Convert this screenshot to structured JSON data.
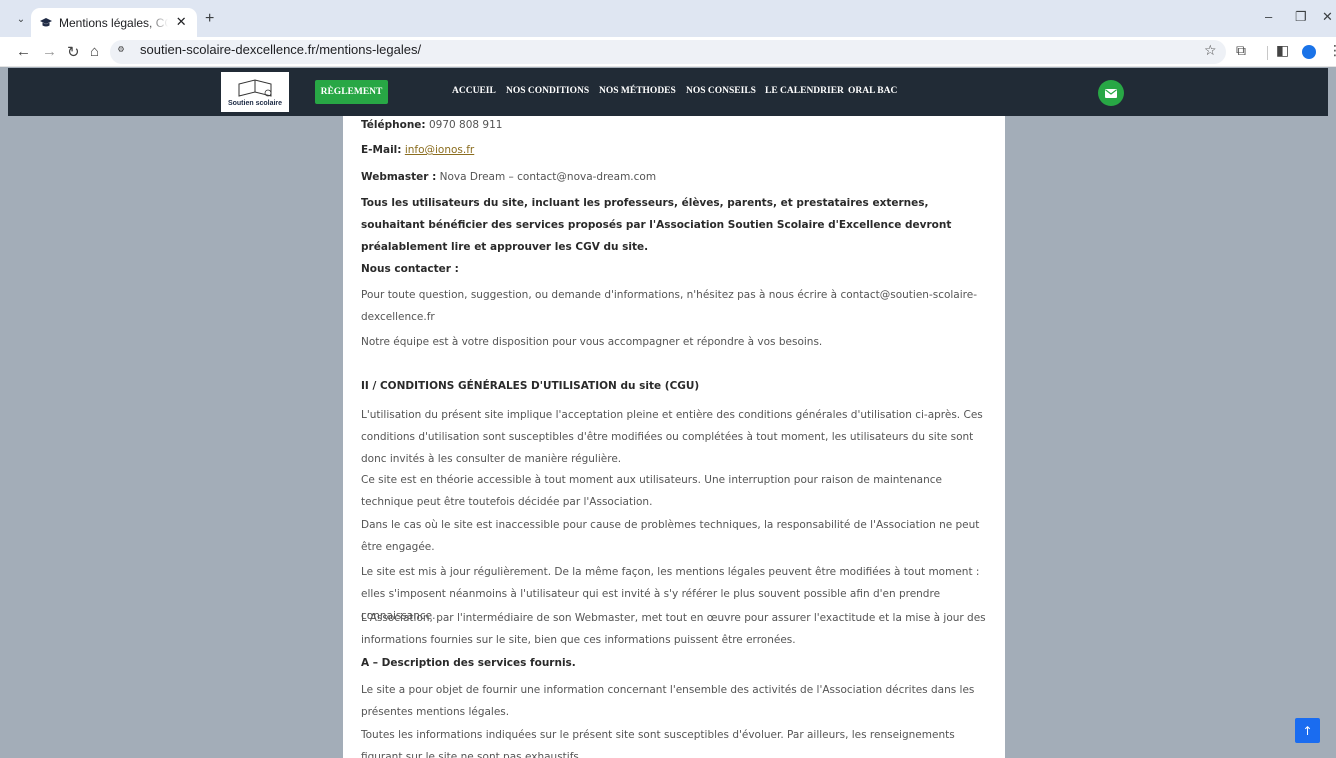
{
  "browser": {
    "tab_title": "Mentions légales, CGU et politique",
    "tab_list_icon": "⌄",
    "close_tab": "✕",
    "new_tab": "+",
    "url": "soutien-scolaire-dexcellence.fr/mentions-legales/",
    "window": {
      "minimize": "–",
      "maximize": "❐",
      "close": "✕"
    }
  },
  "site": {
    "logo_text": "Soutien scolaire",
    "button_reglement": "RÈGLEMENT",
    "menu": [
      "ACCUEIL",
      "NOS CONDITIONS",
      "NOS MÉTHODES",
      "NOS CONSEILS",
      "LE CALENDRIER",
      "ORAL BAC"
    ]
  },
  "content": {
    "telephone_label": "Téléphone:",
    "telephone_value": "0970 808 911",
    "email_label": "E-Mail:",
    "email_value": "info@ionos.fr",
    "webmaster_label": "Webmaster :",
    "webmaster_value": "Nova Dream – contact@nova-dream.com",
    "users_notice": "Tous les utilisateurs du site, incluant les professeurs, élèves, parents, et prestataires externes, souhaitant bénéficier des services proposés par l'Association Soutien Scolaire d'Excellence devront préalablement lire et approuver les CGV du site.",
    "contact_heading": "Nous contacter :",
    "contact_p1": "Pour toute question, suggestion, ou demande d'informations, n'hésitez pas à nous écrire à contact@soutien-scolaire-dexcellence.fr",
    "contact_p2": "Notre équipe est à votre disposition pour vous accompagner et répondre à vos besoins.",
    "cgu_heading": "II / CONDITIONS GÉNÉRALES D'UTILISATION du site (CGU)",
    "cgu_p1": "L'utilisation du présent site implique l'acceptation pleine et entière des conditions générales d'utilisation ci-après. Ces conditions d'utilisation sont susceptibles d'être modifiées ou complétées à tout moment, les utilisateurs du site sont donc invités à les consulter de manière régulière.",
    "cgu_p2": "Ce site est en théorie accessible à tout moment aux utilisateurs. Une interruption pour raison de maintenance technique peut être toutefois décidée par l'Association.",
    "cgu_p3": "Dans le cas où le site est inaccessible pour cause de problèmes techniques, la responsabilité de l'Association ne peut être engagée.",
    "cgu_p4": "Le site est mis à jour régulièrement. De la même façon, les mentions légales peuvent être modifiées à tout moment : elles s'imposent néanmoins à l'utilisateur qui est invité à s'y référer le plus souvent possible afin d'en prendre connaissance.",
    "cgu_p5": "L'Association, par l'intermédiaire de son Webmaster, met tout en œuvre pour assurer l'exactitude et la mise à jour des informations fournies sur le site, bien que ces informations puissent être erronées.",
    "services_heading": "A – Description des services fournis.",
    "services_p1": "Le site a pour objet de fournir une information concernant l'ensemble des activités de l'Association décrites dans les présentes mentions légales.",
    "services_p2": "Toutes les informations indiquées sur le présent site sont susceptibles d'évoluer. Par ailleurs, les renseignements figurant sur le site ne sont pas exhaustifs."
  },
  "colors": {
    "nav_bg": "#212b36",
    "accent_green": "#28a745",
    "page_bg": "#a3adb8",
    "scroll_top": "#1a6cf0"
  },
  "icons": {
    "favicon": "graduation-cap-icon",
    "mail": "envelope-icon",
    "scroll_top": "arrow-up-icon"
  }
}
